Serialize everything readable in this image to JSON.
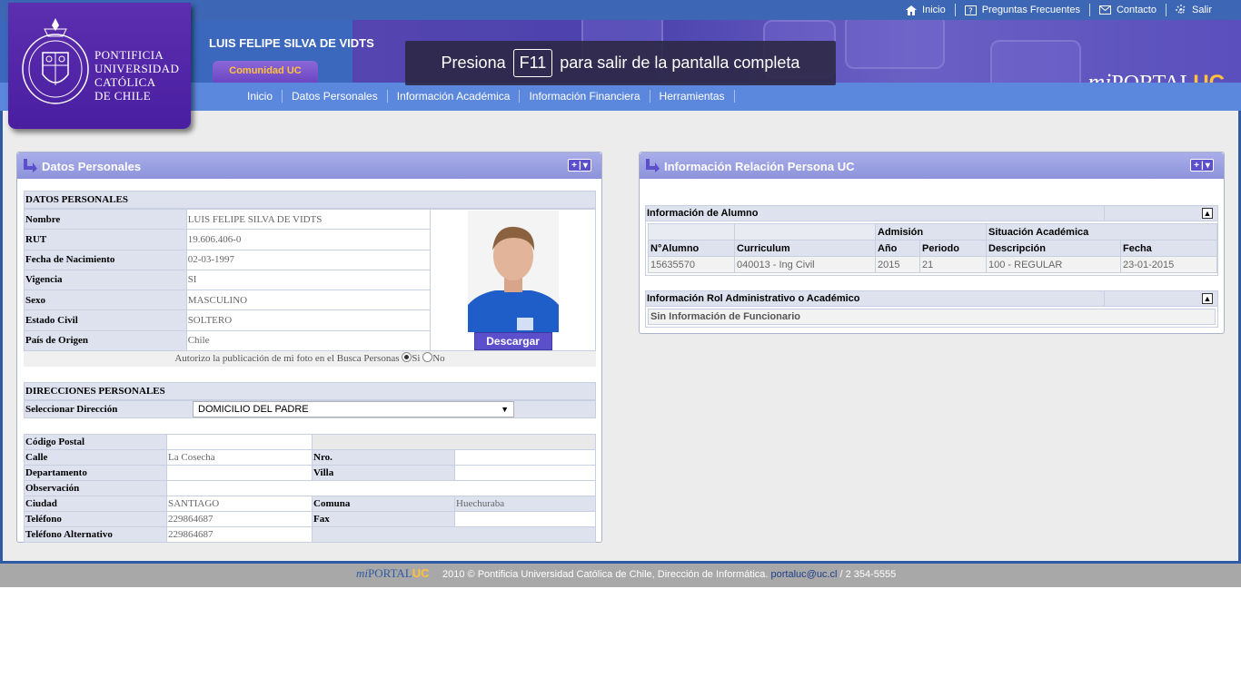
{
  "top_links": {
    "inicio": "Inicio",
    "faq": "Preguntas Frecuentes",
    "contacto": "Contacto",
    "salir": "Salir"
  },
  "header": {
    "user_name": "LUIS FELIPE SILVA DE VIDTS",
    "comunidad": "Comunidad UC",
    "logo_lines": [
      "PONTIFICIA",
      "UNIVERSIDAD",
      "CATÓLICA",
      "DE CHILE"
    ],
    "brand_mi": "mi",
    "brand_portal": "PORTAL",
    "brand_uc": "UC"
  },
  "fullscreen_notice": {
    "before": "Presiona",
    "key": "F11",
    "after": "para salir de la pantalla completa"
  },
  "nav": [
    "Inicio",
    "Datos Personales",
    "Información Académica",
    "Información Financiera",
    "Herramientas"
  ],
  "datos_panel": {
    "title": "Datos Personales",
    "section_title": "DATOS PERSONALES",
    "fields": [
      {
        "label": "Nombre",
        "value": "LUIS FELIPE SILVA DE VIDTS"
      },
      {
        "label": "RUT",
        "value": "19.606.406-0"
      },
      {
        "label": "Fecha de Nacimiento",
        "value": "02-03-1997"
      },
      {
        "label": "Vigencia",
        "value": "SI"
      },
      {
        "label": "Sexo",
        "value": "MASCULINO"
      },
      {
        "label": "Estado Civil",
        "value": "SOLTERO"
      },
      {
        "label": "País de Origen",
        "value": "Chile"
      }
    ],
    "download_label": "Descargar",
    "photo_consent": "Autorizo la publicación de mi foto en el Busca Personas",
    "consent_yes": "Si",
    "consent_no": "No",
    "consent_selected": "Si",
    "direcciones_title": "DIRECCIONES PERSONALES",
    "select_label": "Seleccionar Dirección",
    "select_value": "DOMICILIO DEL PADRE",
    "address": {
      "codigo_postal": {
        "label": "Código Postal",
        "value": ""
      },
      "calle": {
        "label": "Calle",
        "value": "La Cosecha"
      },
      "nro": {
        "label": "Nro.",
        "value": ""
      },
      "departamento": {
        "label": "Departamento",
        "value": ""
      },
      "villa": {
        "label": "Villa",
        "value": ""
      },
      "observacion": {
        "label": "Observación",
        "value": ""
      },
      "ciudad": {
        "label": "Ciudad",
        "value": "SANTIAGO"
      },
      "comuna": {
        "label": "Comuna",
        "value": "Huechuraba"
      },
      "telefono": {
        "label": "Teléfono",
        "value": "229864687"
      },
      "fax": {
        "label": "Fax",
        "value": ""
      },
      "telefono_alt": {
        "label": "Teléfono Alternativo",
        "value": "229864687"
      }
    }
  },
  "relacion_panel": {
    "title": "Información Relación Persona UC",
    "alumno": {
      "title": "Información de Alumno",
      "group_admision": "Admisión",
      "group_situacion": "Situación Académica",
      "headers": [
        "N°Alumno",
        "Curriculum",
        "Año",
        "Periodo",
        "Descripción",
        "Fecha"
      ],
      "row": [
        "15635570",
        "040013 - Ing Civil",
        "2015",
        "21",
        "100 - REGULAR",
        "23-01-2015"
      ]
    },
    "rol": {
      "title": "Información Rol Administrativo o Académico",
      "message": "Sin Información de Funcionario"
    }
  },
  "footer": {
    "brand_mi": "mi",
    "brand_portal": "PORTAL",
    "brand_uc": "UC",
    "text": "2010 © Pontificia Universidad Católica de Chile, Dirección de Informática.",
    "email": "portaluc@uc.cl",
    "phone": " / 2 354-5555"
  },
  "colors": {
    "header_blue": "#3d67b4",
    "nav_blue": "#5b88dc",
    "logo_purple": "#5c2fb0",
    "panel_head": "#a9aee9",
    "accent_yellow": "#ffc23a"
  }
}
